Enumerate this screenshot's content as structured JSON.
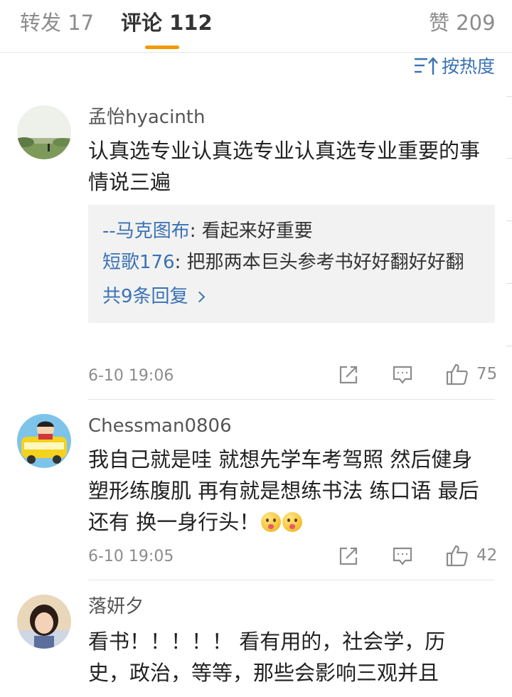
{
  "tabs": [
    {
      "label": "转发",
      "count": "17"
    },
    {
      "label": "评论",
      "count": "112",
      "active": true
    },
    {
      "label": "赞",
      "count": "209"
    }
  ],
  "sort": {
    "label": "按热度",
    "icon": "sort-icon"
  },
  "accent_color": "#f39800",
  "link_color": "#3a72b4",
  "comments": [
    {
      "user": "孟怡hyacinth",
      "text": "认真选专业认真选专业认真选专业重要的事情说三遍",
      "replies": [
        {
          "user": "--马克图布",
          "text": ": 看起来好重要"
        },
        {
          "user": "短歌176",
          "text": ": 把那两本巨头参考书好好翻好好翻"
        }
      ],
      "more_replies": "共9条回复",
      "time": "6-10 19:06",
      "likes": "75"
    },
    {
      "user": "Chessman0806",
      "text": "我自己就是哇 就想先学车考驾照 然后健身塑形练腹肌 再有就是想练书法 练口语 最后还有 换一身行头！",
      "time": "6-10 19:05",
      "likes": "42"
    },
    {
      "user": "落妍夕",
      "text": "看书！！！！！ 看有用的，社会学，历史，政治，等等，那些会影响三观并且"
    }
  ]
}
